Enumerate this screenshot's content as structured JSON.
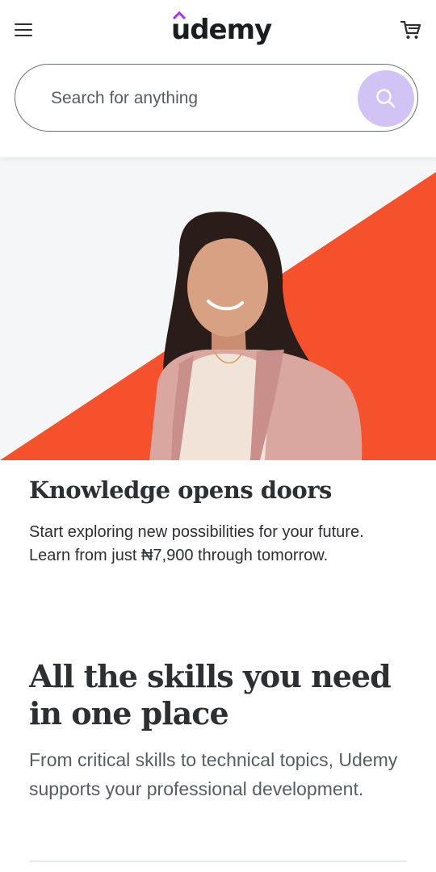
{
  "header": {
    "logo_text": "udemy",
    "menu_icon": "hamburger-menu-icon",
    "cart_icon": "shopping-cart-icon",
    "brand_accent": "#a435f0"
  },
  "search": {
    "placeholder": "Search for anything",
    "value": "",
    "button_icon": "search-icon",
    "button_color": "#d1c4f4"
  },
  "hero": {
    "accent_color": "#f4512c",
    "background_color": "#f5f6f8"
  },
  "promo": {
    "title": "Knowledge opens doors",
    "line1": "Start exploring new possibilities for your future.",
    "line2": "Learn from just ₦7,900 through tomorrow."
  },
  "skills": {
    "title": "All the skills you need in one place",
    "description": "From critical skills to technical topics, Udemy supports your professional development."
  }
}
